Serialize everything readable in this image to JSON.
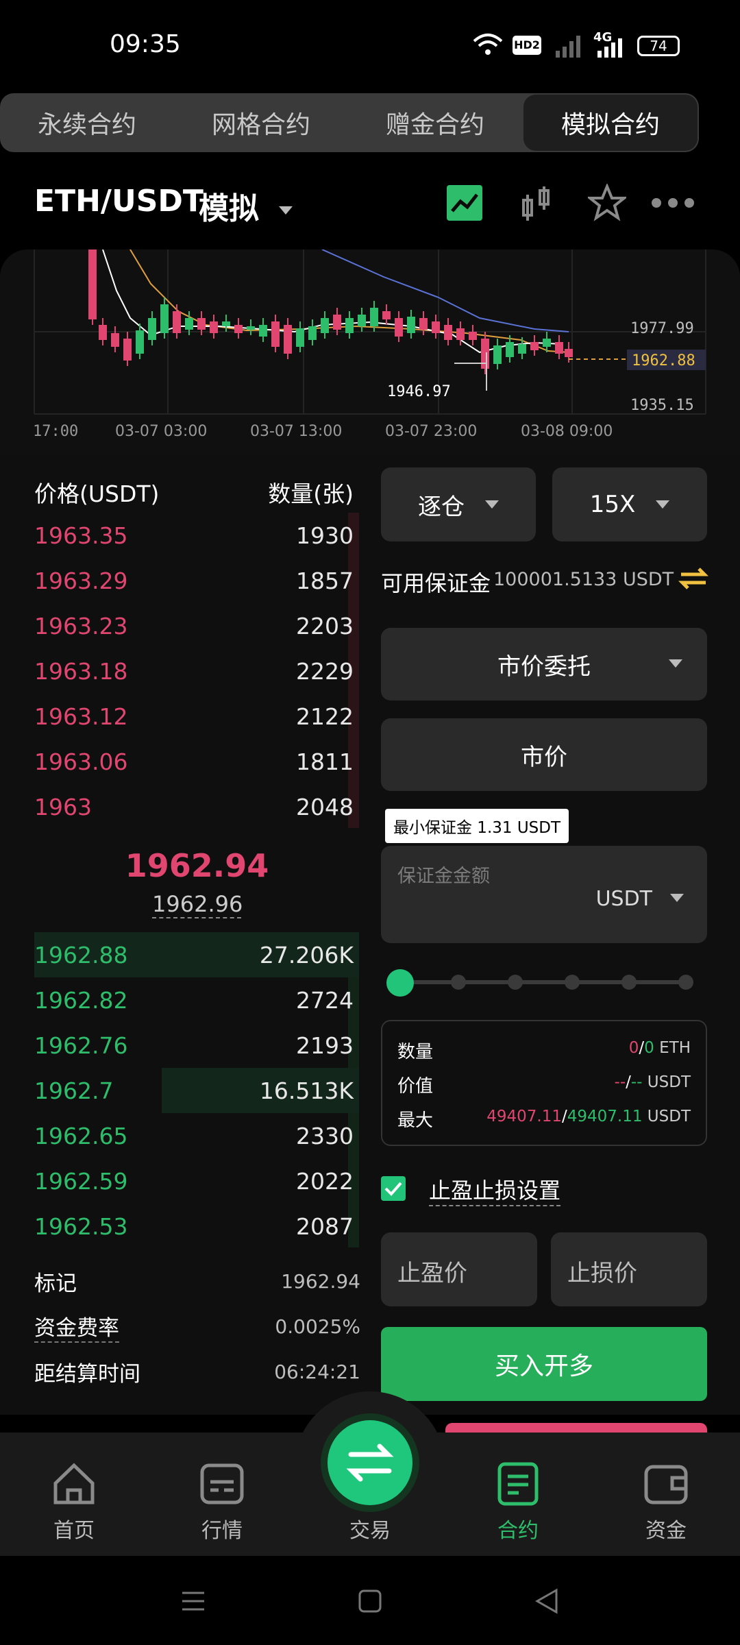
{
  "status": {
    "time": "09:35",
    "battery": "74",
    "hd_label": "HD2",
    "network": "4G"
  },
  "tabs": [
    "永续合约",
    "网格合约",
    "赠金合约",
    "模拟合约"
  ],
  "active_tab": 3,
  "header": {
    "pair": "ETH/USDT",
    "mode": "模拟"
  },
  "chart": {
    "price_labels": [
      "1977.99",
      "1962.88",
      "1935.15"
    ],
    "low_marker": "1946.97",
    "time_labels": [
      "17:00",
      "03-07 03:00",
      "03-07 13:00",
      "03-07 23:00",
      "03-08 09:00"
    ]
  },
  "orderbook": {
    "price_header": "价格(USDT)",
    "qty_header": "数量(张)",
    "asks": [
      {
        "price": "1963.35",
        "qty": "1930"
      },
      {
        "price": "1963.29",
        "qty": "1857"
      },
      {
        "price": "1963.23",
        "qty": "2203"
      },
      {
        "price": "1963.18",
        "qty": "2229"
      },
      {
        "price": "1963.12",
        "qty": "2122"
      },
      {
        "price": "1963.06",
        "qty": "1811"
      },
      {
        "price": "1963",
        "qty": "2048"
      }
    ],
    "last_price": "1962.94",
    "mark_sub": "1962.96",
    "bids": [
      {
        "price": "1962.88",
        "qty": "27.206K"
      },
      {
        "price": "1962.82",
        "qty": "2724"
      },
      {
        "price": "1962.76",
        "qty": "2193"
      },
      {
        "price": "1962.7",
        "qty": "16.513K"
      },
      {
        "price": "1962.65",
        "qty": "2330"
      },
      {
        "price": "1962.59",
        "qty": "2022"
      },
      {
        "price": "1962.53",
        "qty": "2087"
      }
    ],
    "info": [
      {
        "label": "标记",
        "value": "1962.94"
      },
      {
        "label": "资金费率",
        "value": "0.0025%"
      },
      {
        "label": "距结算时间",
        "value": "06:24:21"
      }
    ]
  },
  "trade": {
    "margin_mode": "逐仓",
    "leverage": "15X",
    "available_label": "可用保证金",
    "available_value": "100001.5133 USDT",
    "order_type": "市价委托",
    "price_field": "市价",
    "tooltip": "最小保证金 1.31 USDT",
    "amount_placeholder": "保证金金额",
    "amount_unit": "USDT",
    "summary": {
      "qty_label": "数量",
      "qty_a": "0",
      "qty_sep": "/",
      "qty_b": "0",
      "qty_unit": "ETH",
      "value_label": "价值",
      "value_a": "--",
      "value_sep": "/",
      "value_b": "--",
      "value_unit": "USDT",
      "max_label": "最大",
      "max_a": "49407.11",
      "max_sep": "/",
      "max_b": "49407.11",
      "max_unit": "USDT"
    },
    "tpsl_label": "止盈止损设置",
    "tp_placeholder": "止盈价",
    "sl_placeholder": "止损价",
    "buy_label": "买入开多"
  },
  "nav": [
    "首页",
    "行情",
    "交易",
    "合约",
    "资金"
  ],
  "active_nav": 3,
  "colors": {
    "green": "#2ebd6b",
    "red": "#e0466f",
    "yellow": "#f0c040"
  }
}
